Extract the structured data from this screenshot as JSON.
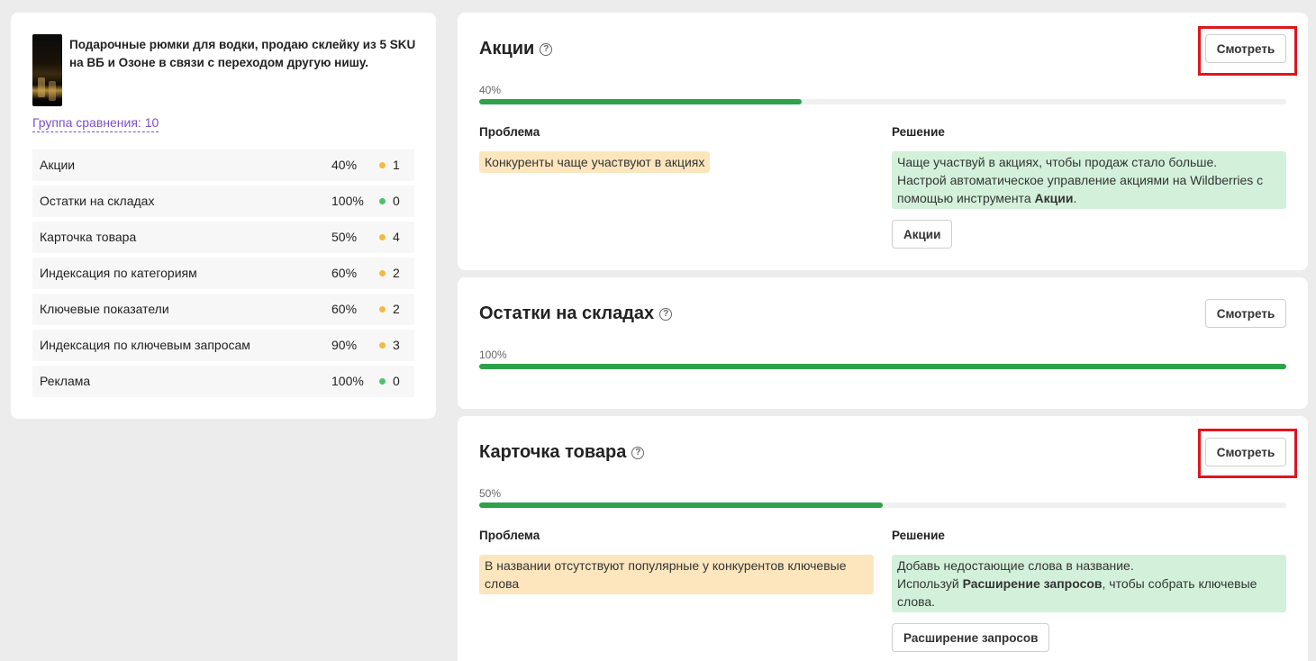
{
  "product": {
    "title": "Подарочные рюмки для водки, продаю склейку из 5 SKU на ВБ и Озоне в связи с переходом другую нишу.",
    "compare_group": "Группа сравнения: 10"
  },
  "metrics": [
    {
      "label": "Акции",
      "percent": "40%",
      "count": "1",
      "dot_color": "#f5b93d"
    },
    {
      "label": "Остатки на складах",
      "percent": "100%",
      "count": "0",
      "dot_color": "#4cc26b"
    },
    {
      "label": "Карточка товара",
      "percent": "50%",
      "count": "4",
      "dot_color": "#f5b93d"
    },
    {
      "label": "Индексация по категориям",
      "percent": "60%",
      "count": "2",
      "dot_color": "#f5b93d"
    },
    {
      "label": "Ключевые показатели",
      "percent": "60%",
      "count": "2",
      "dot_color": "#f5b93d"
    },
    {
      "label": "Индексация по ключевым запросам",
      "percent": "90%",
      "count": "3",
      "dot_color": "#f5b93d"
    },
    {
      "label": "Реклама",
      "percent": "100%",
      "count": "0",
      "dot_color": "#4cc26b"
    }
  ],
  "cards": [
    {
      "title": "Акции",
      "view_label": "Смотреть",
      "percent_label": "40%",
      "progress": 0.4,
      "problem_header": "Проблема",
      "solution_header": "Решение",
      "problem": "Конкуренты чаще участвуют в акциях",
      "solution_line1": "Чаще участвуй в акциях, чтобы продаж стало больше.",
      "solution_line2_pre": "Настрой автоматическое управление акциями на Wildberries с помощью инструмента ",
      "solution_line2_bold": "Акции",
      "solution_line2_post": ".",
      "tool_button": "Акции"
    },
    {
      "title": "Остатки на складах",
      "view_label": "Смотреть",
      "percent_label": "100%",
      "progress": 1.0
    },
    {
      "title": "Карточка товара",
      "view_label": "Смотреть",
      "percent_label": "50%",
      "progress": 0.5,
      "problem_header": "Проблема",
      "solution_header": "Решение",
      "problem": "В названии отсутствуют популярные у конкурентов ключевые слова",
      "solution_line1": "Добавь недостающие слова в название.",
      "solution_line2_pre": "Используй ",
      "solution_line2_bold": "Расширение запросов",
      "solution_line2_post": ", чтобы собрать ключевые слова.",
      "tool_button": "Расширение запросов"
    }
  ],
  "help_icon_glyph": "?",
  "colors": {
    "progress": "#2ea14a",
    "highlight": "#e0151d",
    "problem_bg": "#fde6be",
    "solution_bg": "#d3f1da",
    "link": "#7b4fc9"
  }
}
